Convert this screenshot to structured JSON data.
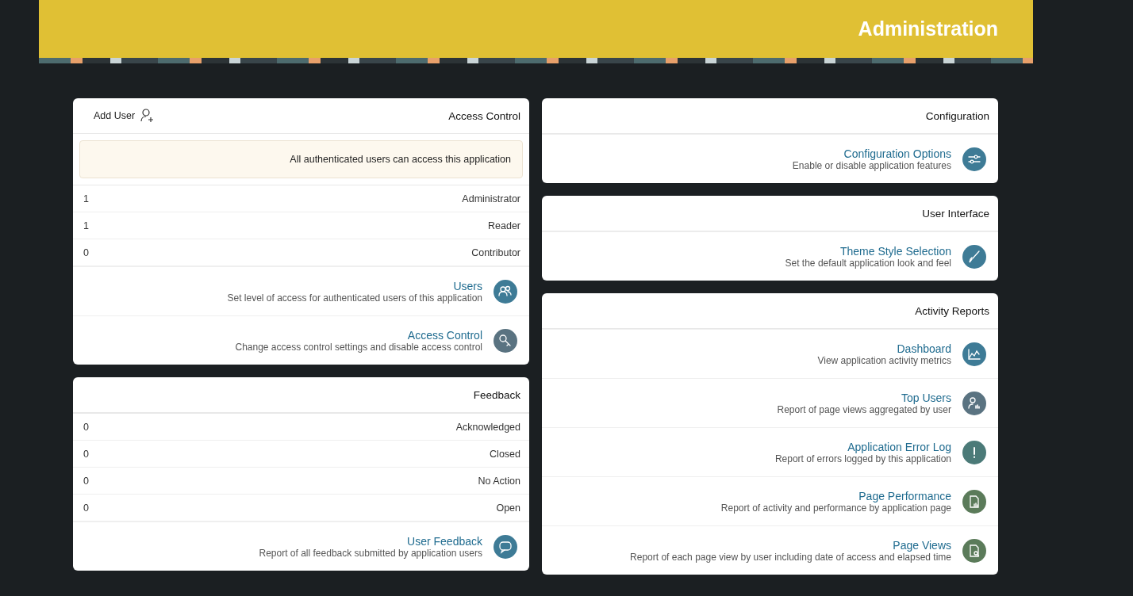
{
  "header": {
    "title": "Administration"
  },
  "columns": [
    [
      {
        "title": "Access Control",
        "action": "Add User",
        "notice": "All authenticated users can access this application",
        "counts": [
          {
            "count": "1",
            "label": "Administrator"
          },
          {
            "count": "1",
            "label": "Reader"
          },
          {
            "count": "0",
            "label": "Contributor"
          }
        ],
        "links": [
          {
            "kind": "users",
            "color": "#3e7b96",
            "title": "Users",
            "description": "Set level of access for authenticated users of this application"
          },
          {
            "kind": "key",
            "color": "#5a7381",
            "title": "Access Control",
            "description": "Change access control settings and disable access control"
          }
        ]
      },
      {
        "title": "Feedback",
        "counts": [
          {
            "count": "0",
            "label": "Acknowledged"
          },
          {
            "count": "0",
            "label": "Closed"
          },
          {
            "count": "0",
            "label": "No Action"
          },
          {
            "count": "0",
            "label": "Open"
          }
        ],
        "links": [
          {
            "kind": "chat",
            "color": "#3e7b96",
            "title": "User Feedback",
            "description": "Report of all feedback submitted by application users"
          }
        ]
      }
    ],
    [
      {
        "title": "Configuration",
        "links": [
          {
            "kind": "sliders",
            "color": "#3e7b96",
            "title": "Configuration Options",
            "description": "Enable or disable application features"
          }
        ]
      },
      {
        "title": "User Interface",
        "links": [
          {
            "kind": "brush",
            "color": "#3e7b96",
            "title": "Theme Style Selection",
            "description": "Set the default application look and feel"
          }
        ]
      },
      {
        "title": "Activity Reports",
        "links": [
          {
            "kind": "chart",
            "color": "#3e7b96",
            "title": "Dashboard",
            "description": "View application activity metrics"
          },
          {
            "kind": "user-report",
            "color": "#5a7381",
            "title": "Top Users",
            "description": "Report of page views aggregated by user"
          },
          {
            "kind": "alert",
            "color": "#4b7a78",
            "title": "Application Error Log",
            "description": "Report of errors logged by this application"
          },
          {
            "kind": "page-report",
            "color": "#5b7b5a",
            "title": "Page Performance",
            "description": "Report of activity and performance by application page"
          },
          {
            "kind": "page-search",
            "color": "#5b7b5a",
            "title": "Page Views",
            "description": "Report of each page view by user including date of access and elapsed time"
          }
        ]
      }
    ]
  ]
}
